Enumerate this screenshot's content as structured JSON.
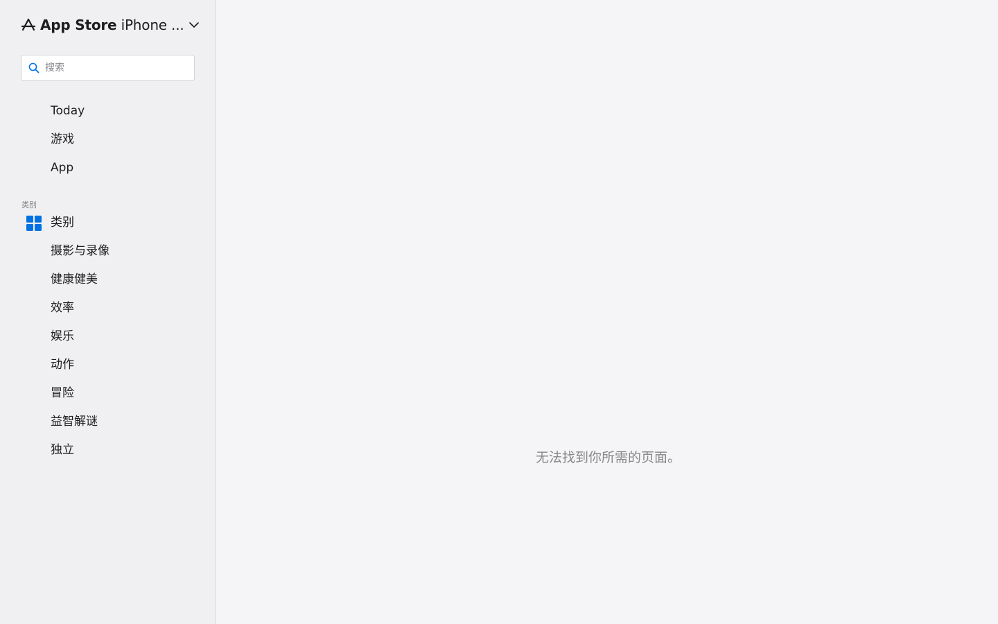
{
  "brand": {
    "title_strong": "App Store",
    "title_light": "iPhone ...",
    "icon": "app-store-icon",
    "chevron_icon": "chevron-down-icon"
  },
  "search": {
    "placeholder": "搜索",
    "value": "",
    "icon": "search-icon"
  },
  "sidebar": {
    "primary_items": [
      {
        "label": "Today"
      },
      {
        "label": "游戏"
      },
      {
        "label": "App"
      }
    ],
    "section_label": "类别",
    "categories_item": {
      "label": "类别",
      "icon": "category-grid-icon",
      "icon_color": "#0071e3"
    },
    "category_items": [
      {
        "label": "摄影与录像"
      },
      {
        "label": "健康健美"
      },
      {
        "label": "效率"
      },
      {
        "label": "娱乐"
      },
      {
        "label": "动作"
      },
      {
        "label": "冒险"
      },
      {
        "label": "益智解谜"
      },
      {
        "label": "独立"
      }
    ]
  },
  "main": {
    "empty_message": "无法找到你所需的页面。"
  },
  "colors": {
    "accent": "#0071e3",
    "sidebar_bg": "#f0f0f2",
    "main_bg": "#f5f5f7",
    "muted_text": "#86868b"
  }
}
